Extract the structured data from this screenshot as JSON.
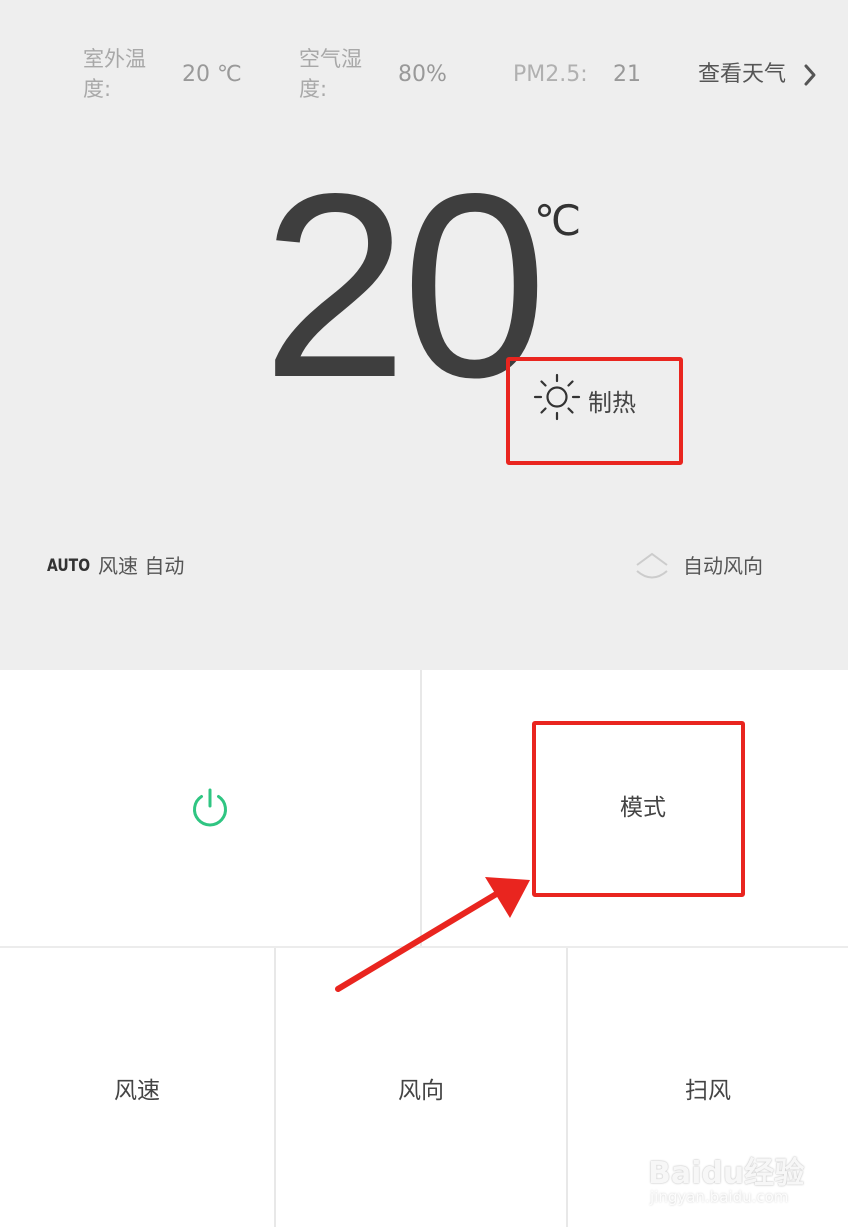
{
  "env": {
    "outdoor_temp_label": "室外温度:",
    "outdoor_temp_value": "20 ℃",
    "humidity_label": "空气湿度:",
    "humidity_value": "80%",
    "pm_label": "PM2.5:",
    "pm_value": "21",
    "weather_link": "查看天气"
  },
  "display": {
    "temperature": "20",
    "unit": "℃",
    "mode_icon": "sun-icon",
    "mode_label": "制热"
  },
  "status": {
    "fan_badge": "AUTO",
    "fan_text": "风速 自动",
    "direction_icon": "wind-direction-icon",
    "direction_text": "自动风向"
  },
  "controls": {
    "power_icon": "power-icon",
    "mode": "模式",
    "fan_speed": "风速",
    "direction": "风向",
    "swing": "扫风"
  },
  "annotations": {
    "highlight_color": "#e9251f"
  },
  "watermark": {
    "brand": "Baidu经验",
    "url": "jingyan.baidu.com"
  },
  "colors": {
    "top_bg": "#eeeeee",
    "power_green": "#2fc582",
    "text_dark": "#3e3e3e"
  }
}
